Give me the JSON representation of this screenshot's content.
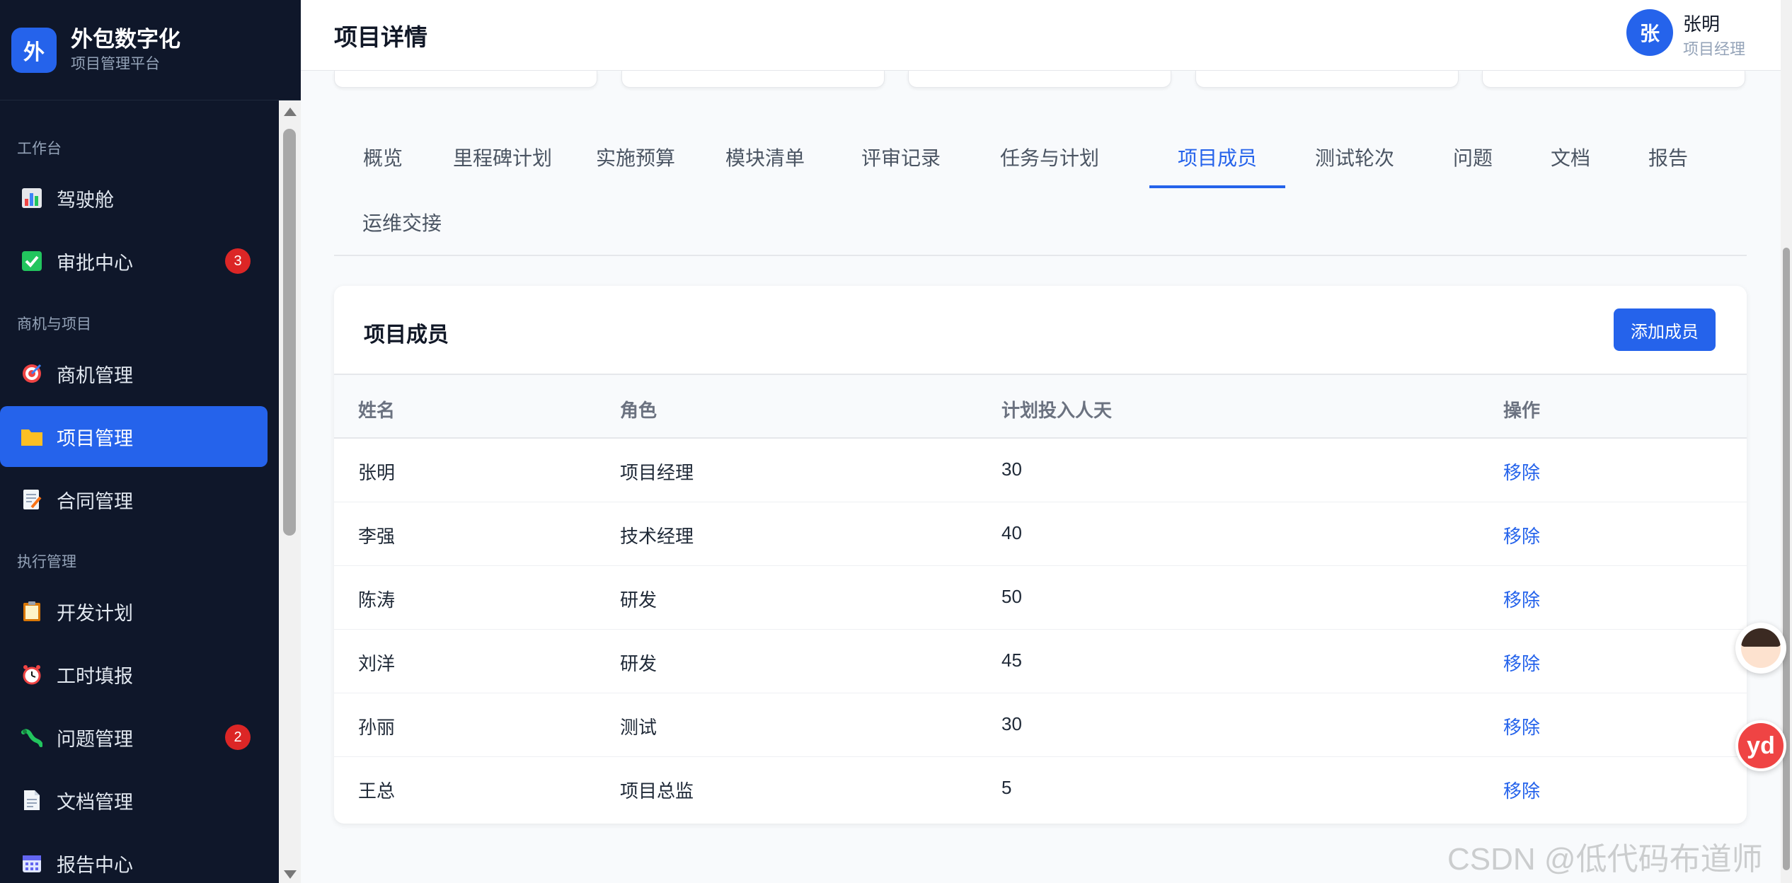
{
  "brand": {
    "logo_char": "外",
    "title": "外包数字化",
    "subtitle": "项目管理平台"
  },
  "sidebar": {
    "groups": [
      "工作台",
      "商机与项目",
      "执行管理"
    ],
    "items": [
      {
        "label": "驾驶舱",
        "icon": "dashboard-icon"
      },
      {
        "label": "审批中心",
        "icon": "check-icon",
        "badge": "3"
      },
      {
        "label": "商机管理",
        "icon": "target-icon"
      },
      {
        "label": "项目管理",
        "icon": "folder-icon",
        "active": true
      },
      {
        "label": "合同管理",
        "icon": "contract-icon"
      },
      {
        "label": "开发计划",
        "icon": "clipboard-icon"
      },
      {
        "label": "工时填报",
        "icon": "clock-icon"
      },
      {
        "label": "问题管理",
        "icon": "bug-icon",
        "badge": "2"
      },
      {
        "label": "文档管理",
        "icon": "document-icon"
      },
      {
        "label": "报告中心",
        "icon": "calendar-icon"
      }
    ]
  },
  "header": {
    "title": "项目详情"
  },
  "user": {
    "avatar_char": "张",
    "name": "张明",
    "role": "项目经理"
  },
  "tabs": [
    "概览",
    "里程碑计划",
    "实施预算",
    "模块清单",
    "评审记录",
    "任务与计划",
    "项目成员",
    "测试轮次",
    "问题",
    "文档",
    "报告",
    "运维交接"
  ],
  "active_tab": "项目成员",
  "members": {
    "title": "项目成员",
    "add_button": "添加成员",
    "columns": [
      "姓名",
      "角色",
      "计划投入人天",
      "操作"
    ],
    "rows": [
      {
        "name": "张明",
        "role": "项目经理",
        "days": "30",
        "action": "移除"
      },
      {
        "name": "李强",
        "role": "技术经理",
        "days": "40",
        "action": "移除"
      },
      {
        "name": "陈涛",
        "role": "研发",
        "days": "50",
        "action": "移除"
      },
      {
        "name": "刘洋",
        "role": "研发",
        "days": "45",
        "action": "移除"
      },
      {
        "name": "孙丽",
        "role": "测试",
        "days": "30",
        "action": "移除"
      },
      {
        "name": "王总",
        "role": "项目总监",
        "days": "5",
        "action": "移除"
      }
    ]
  },
  "floating": {
    "yd_label": "yd"
  },
  "watermark": "CSDN @低代码布道师",
  "colors": {
    "sidebar_bg": "#0f172a",
    "accent": "#2563eb",
    "badge": "#dc2626"
  }
}
